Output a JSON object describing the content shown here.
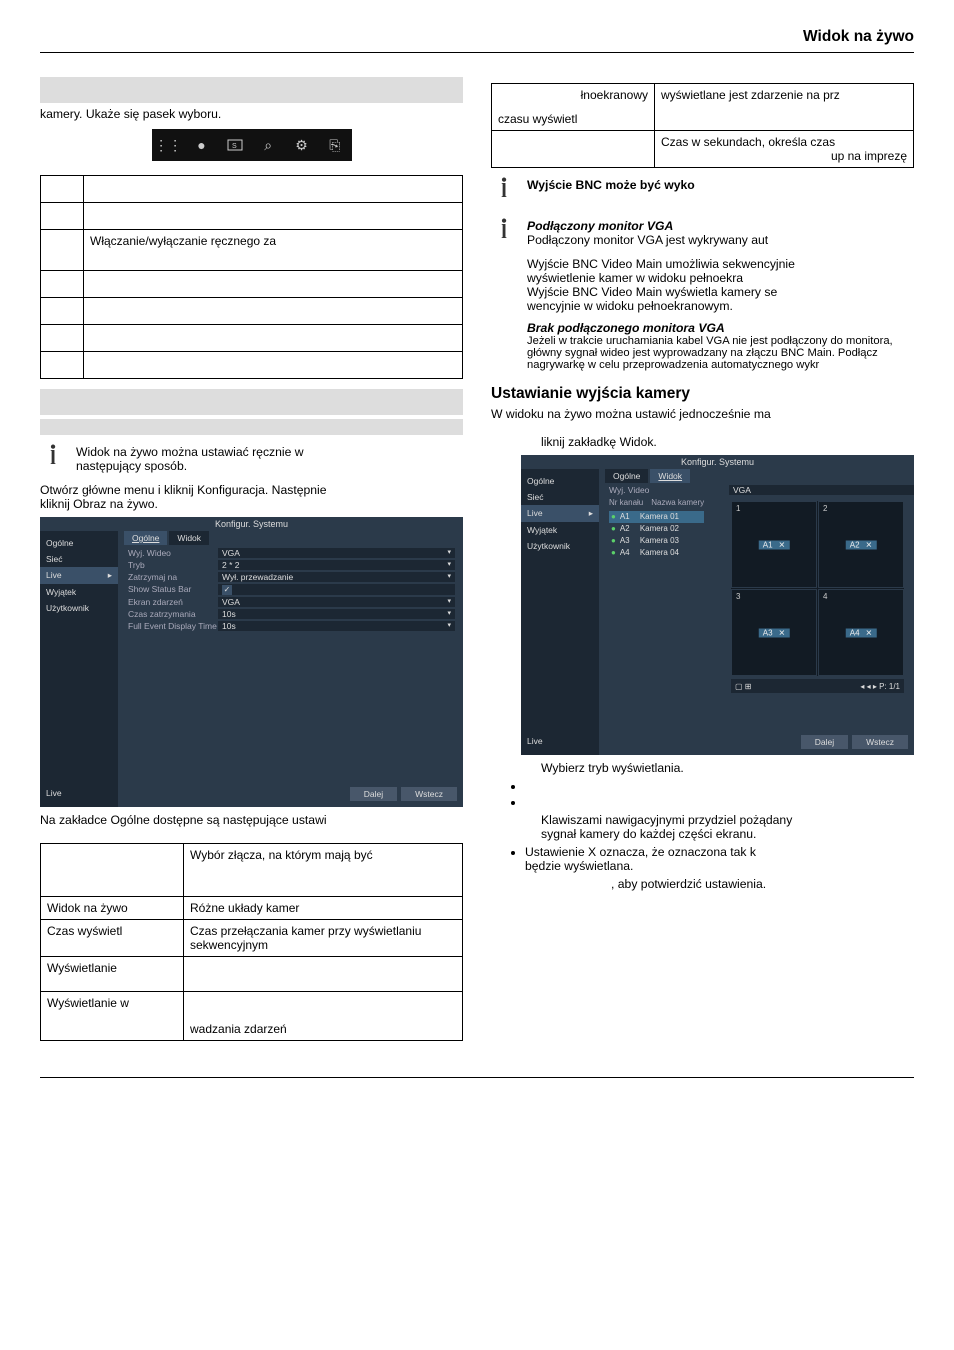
{
  "header": {
    "title": "Widok na żywo"
  },
  "left": {
    "intro": "kamery. Ukaże się pasek wyboru.",
    "icon_row": "Włączanie/wyłączanie ręcznego za",
    "info1_line1": "Widok na żywo można ustawiać ręcznie w",
    "info1_line2": "następujący sposób.",
    "open_main_menu_1": "Otwórz główne menu i kliknij Konfiguracja. Następnie",
    "open_main_menu_2": "kliknij Obraz na żywo.",
    "ss_general": {
      "title": "Konfigur. Systemu",
      "nav": [
        "Ogólne",
        "Sieć",
        "Live",
        "Wyjątek",
        "Użytkownik"
      ],
      "nav_active": "Live",
      "tabs": [
        "Ogólne",
        "Widok"
      ],
      "tab_active": "Ogólne",
      "rows": [
        {
          "lab": "Wyj. Wideo",
          "val": "VGA",
          "drop": true
        },
        {
          "lab": "Tryb",
          "val": "2 * 2",
          "drop": true
        },
        {
          "lab": "Zatrzymaj na",
          "val": "Wył. przewadzanie",
          "drop": true
        },
        {
          "lab": "Show Status Bar",
          "val_check": true
        },
        {
          "lab": "Ekran zdarzeń",
          "val": "VGA",
          "drop": true
        },
        {
          "lab": "Czas zatrzymania",
          "val": "10s",
          "drop": true
        },
        {
          "lab": "Full Event Display Time",
          "val": "10s",
          "drop": true
        }
      ],
      "foot": [
        "Dalej",
        "Wstecz"
      ],
      "bottom_left": "Live"
    },
    "after_ss": "Na zakładce Ogólne dostępne są następujące ustawi",
    "table2": [
      {
        "c1": "",
        "c2": "Wybór złącza, na którym mają być"
      },
      {
        "c1": "Widok na żywo",
        "c2": "Różne układy kamer"
      },
      {
        "c1": "Czas wyświetl",
        "c2": "Czas przełączania kamer przy wyświetlaniu sekwencyjnym"
      },
      {
        "c1": "Wyświetlanie",
        "c2": ""
      },
      {
        "c1": "Wyświetlanie w",
        "c2": "wadzania zdarzeń",
        "c2pre": ""
      }
    ]
  },
  "right": {
    "top_table": {
      "r1c1a": "łnoekranowy",
      "r1c1b": "czasu wyświetl",
      "r1c2": "wyświetlane jest zdarzenie na prz",
      "r2c2a": "Czas w sekundach, określa czas",
      "r2c2b": "up na imprezę"
    },
    "info_bnc": "Wyjście BNC może być wyko",
    "vga_h": "Podłączony monitor VGA",
    "vga_l1": "Podłączony monitor VGA jest wykrywany aut",
    "vga_l2": "Wyjście BNC Video Main umożliwia sekwencyjnie",
    "vga_l3": "wyświetlenie kamer w widoku pełnoekra",
    "vga_l4": "Wyjście BNC Video Main wyświetla kamery se",
    "vga_l5": "wencyjnie w widoku pełnoekranowym.",
    "novga_h": "Brak podłączonego monitora VGA",
    "novga_l1": "Jeżeli w trakcie uruchamiania kabel VGA nie jest podłączony do monitora, główny sygnał wideo jest wyprowadzany na złączu BNC Main. Podłącz",
    "novga_l2": "nagrywarkę w celu przeprowadzenia automatycznego wykr",
    "section_title": "Ustawianie wyjścia kamery",
    "section_sub": "W widoku na żywo można ustawić jednocześnie ma",
    "click_tab": "liknij zakładkę Widok.",
    "ss_view": {
      "title": "Konfigur. Systemu",
      "nav": [
        "Ogólne",
        "Sieć",
        "Live",
        "Wyjątek",
        "Użytkownik"
      ],
      "nav_active": "Live",
      "tabs": [
        "Ogólne",
        "Widok"
      ],
      "tab_active": "Widok",
      "wyj_label": "Wyj. Video",
      "wyj_val": "VGA",
      "cam_hdr": [
        "Nr kanału",
        "Nazwa kamery"
      ],
      "cams": [
        {
          "n": "A1",
          "name": "Kamera 01",
          "sel": true
        },
        {
          "n": "A2",
          "name": "Kamera 02"
        },
        {
          "n": "A3",
          "name": "Kamera 03"
        },
        {
          "n": "A4",
          "name": "Kamera 04"
        }
      ],
      "quad": [
        {
          "n": "1",
          "tag": "A1"
        },
        {
          "n": "2",
          "tag": "A2"
        },
        {
          "n": "3",
          "tag": "A3"
        },
        {
          "n": "4",
          "tag": "A4"
        }
      ],
      "foot": [
        "Dalej",
        "Wstecz"
      ],
      "bottom_left": "Live"
    },
    "choose_mode": "Wybierz tryb wyświetlania.",
    "nav_keys_1": "Klawiszami nawigacyjnymi przydziel pożądany",
    "nav_keys_2": "sygnał kamery do każdej części ekranu.",
    "x_setting_1": "Ustawienie X oznacza, że oznaczona tak k",
    "x_setting_2": "będzie wyświetlana.",
    "confirm": ", aby potwierdzić ustawienia."
  }
}
